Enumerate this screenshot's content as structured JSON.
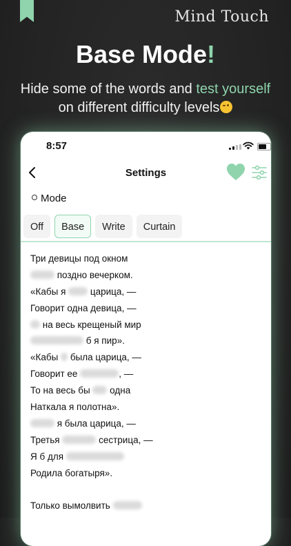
{
  "header": {
    "brand": "Mind Touch",
    "headline_main": "Base Mode",
    "headline_accent": "!",
    "subline_pre": "Hide some of the words and ",
    "subline_accent": "test yourself",
    "subline_post": " on different difficulty levels"
  },
  "phone": {
    "status_time": "8:57",
    "nav_title": "Settings",
    "mode_label": "Mode",
    "tabs": [
      {
        "label": "Off",
        "active": false
      },
      {
        "label": "Base",
        "active": true
      },
      {
        "label": "Write",
        "active": false
      },
      {
        "label": "Curtain",
        "active": false
      }
    ],
    "poem": [
      {
        "t": "Три девицы под окном"
      },
      {
        "h": "Пряли",
        "t": " поздно вечерком."
      },
      {
        "t": "«Кабы я ",
        "h": "была",
        "t2": " царица, —"
      },
      {
        "t": "Говорит одна девица, —"
      },
      {
        "h": "То",
        "t": " на весь крещеный мир"
      },
      {
        "h": "Приготовила",
        "t": " б я пир»."
      },
      {
        "t": "«Кабы ",
        "h": "я",
        "t2": " была царица, —"
      },
      {
        "t": "Говорит ее ",
        "h": "сестрица",
        "t2": ", —"
      },
      {
        "t": "То на весь бы ",
        "h": "мир",
        "t2": " одна"
      },
      {
        "t": "Наткала я полотна»."
      },
      {
        "h": "«Кабы",
        "t": " я была царица, —"
      },
      {
        "t": "Третья ",
        "h": "молвила",
        "t2": " сестрица, —"
      },
      {
        "t": "Я б для ",
        "h": "батюшки-царя"
      },
      {
        "t": "Родила богатыря»."
      },
      {
        "t": ""
      },
      {
        "t": "Только вымолвить ",
        "h": "успела"
      }
    ]
  },
  "colors": {
    "accent": "#8fd4ad",
    "background": "#232323",
    "card": "#ffffff"
  }
}
